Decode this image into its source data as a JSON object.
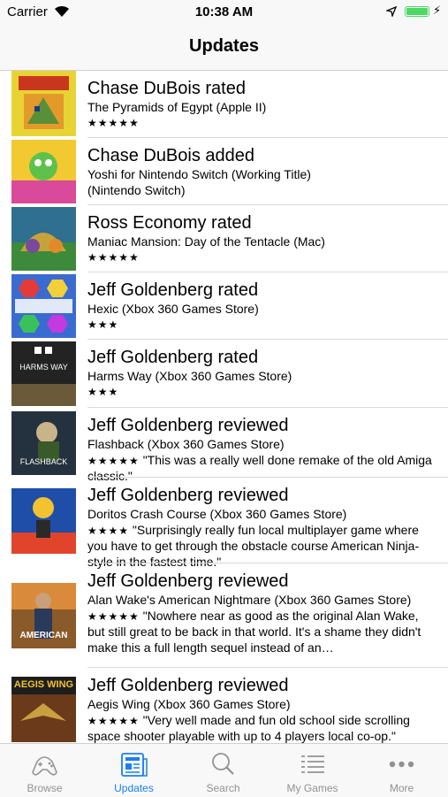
{
  "status": {
    "carrier": "Carrier",
    "time": "10:38 AM",
    "battery_level": 1.0
  },
  "nav": {
    "title": "Updates"
  },
  "feed": [
    {
      "headline": "Chase DuBois rated",
      "game": "The Pyramids of Egypt (Apple II)",
      "stars": "★★★★★"
    },
    {
      "headline": "Chase DuBois added",
      "game": "Yoshi for Nintendo Switch (Working Title)",
      "game2": "(Nintendo Switch)"
    },
    {
      "headline": "Ross Economy rated",
      "game": "Maniac Mansion: Day of the Tentacle (Mac)",
      "stars": "★★★★★"
    },
    {
      "headline": "Jeff Goldenberg rated",
      "game": "Hexic (Xbox 360 Games Store)",
      "stars": "★★★"
    },
    {
      "headline": "Jeff Goldenberg rated",
      "game": "Harms Way (Xbox 360 Games Store)",
      "stars": "★★★",
      "cover_text": "HARMS WAY"
    },
    {
      "headline": "Jeff Goldenberg reviewed",
      "game": "Flashback (Xbox 360 Games Store)",
      "stars": "★★★★★",
      "review": "\"This was a really well done remake of the old Amiga classic.\"",
      "cover_text": "FLASHBACK"
    },
    {
      "headline": "Jeff Goldenberg reviewed",
      "game": "Doritos Crash Course (Xbox 360 Games Store)",
      "stars": "★★★★",
      "review": "\"Surprisingly really fun local multiplayer game where you have to get through the obstacle course American Ninja-style in the fastest time.\""
    },
    {
      "headline": "Jeff Goldenberg reviewed",
      "game": "Alan Wake's American Nightmare (Xbox 360 Games Store)",
      "stars": "★★★★★",
      "review": "\"Nowhere near as good as the original Alan Wake, but still great to be back in that world. It's a shame they didn't make this a full length sequel instead of an…",
      "cover_text": "AMERICAN"
    },
    {
      "headline": "Jeff Goldenberg reviewed",
      "game": "Aegis Wing (Xbox 360 Games Store)",
      "stars": "★★★★★",
      "review": "\"Very well made and fun old school side scrolling space shooter playable with up to 4 players local co-op.\"",
      "cover_text": "AEGIS WING"
    }
  ],
  "tabs": [
    {
      "label": "Browse",
      "icon": "gamepad-icon"
    },
    {
      "label": "Updates",
      "icon": "newspaper-icon",
      "active": true
    },
    {
      "label": "Search",
      "icon": "search-icon"
    },
    {
      "label": "My Games",
      "icon": "list-icon"
    },
    {
      "label": "More",
      "icon": "more-icon"
    }
  ],
  "colors": {
    "accent": "#1a7ff5",
    "tab_inactive": "#929292",
    "battery": "#4cd964"
  }
}
